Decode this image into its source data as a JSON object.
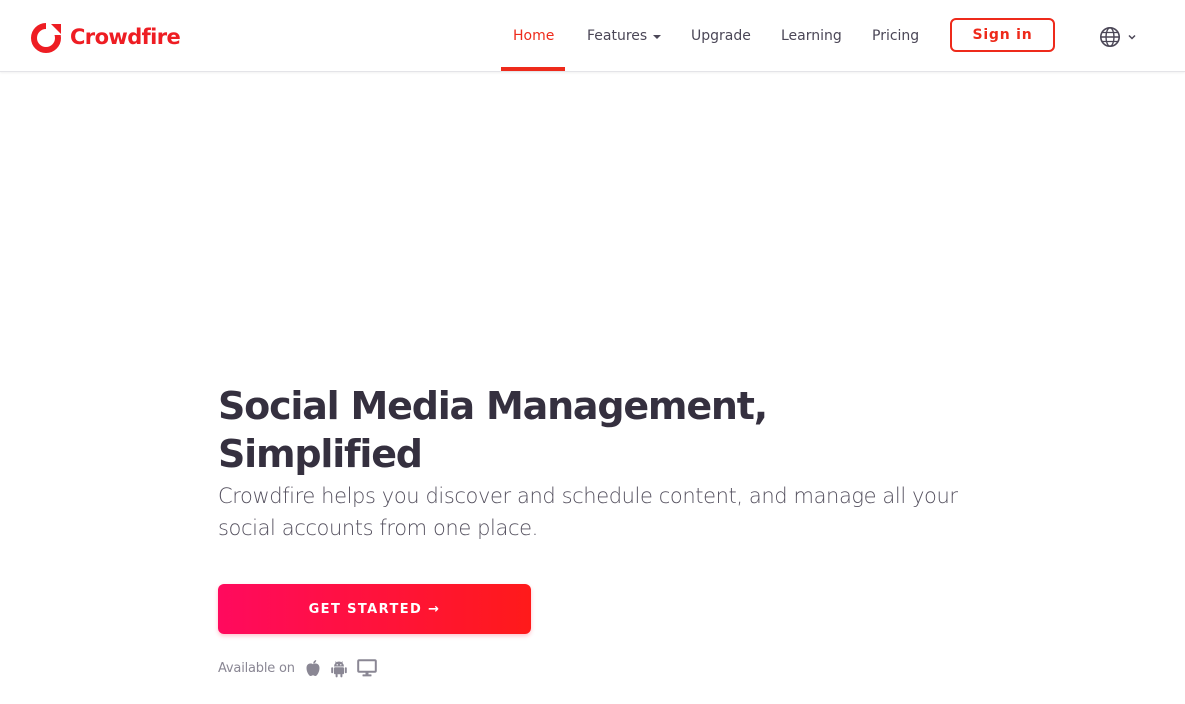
{
  "brand": {
    "name": "Crowdfire",
    "accent_color": "#ee2a1b",
    "logo_icon": "crowdfire-logo-icon"
  },
  "nav": {
    "items": [
      {
        "label": "Home",
        "active": true
      },
      {
        "label": "Features",
        "has_dropdown": true
      },
      {
        "label": "Upgrade"
      },
      {
        "label": "Learning"
      },
      {
        "label": "Pricing"
      }
    ],
    "signin_label": "Sign in",
    "language_icon": "globe-icon"
  },
  "hero": {
    "title_line1": "Social Media Management,",
    "title_line2": "Simplified",
    "subtitle": "Crowdfire helps you discover and schedule content, and manage all your social accounts from one place.",
    "cta_label": "GET STARTED →",
    "cta_gradient": [
      "#ff0a5e",
      "#ff1a1a"
    ],
    "available_label": "Available on",
    "platforms": [
      "apple-icon",
      "android-icon",
      "desktop-icon"
    ]
  }
}
